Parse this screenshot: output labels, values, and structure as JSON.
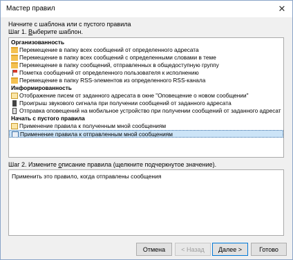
{
  "window": {
    "title": "Мастер правил",
    "close_glyph": "✕"
  },
  "intro": {
    "line1": "Начните с шаблона или с пустого правила",
    "step1_prefix": "Шаг 1. ",
    "step1_acc": "В",
    "step1_suffix": "ыберите шаблон."
  },
  "templates": {
    "groups": [
      {
        "label": "Организованность",
        "items": [
          {
            "icon": "folder-icon",
            "label": "Перемещение в папку всех сообщений от определенного адресата"
          },
          {
            "icon": "folder-icon",
            "label": "Перемещение в папку всех сообщений с определенными словами в теме"
          },
          {
            "icon": "folder-icon",
            "label": "Перемещение в папку сообщений, отправленных в общедоступную группу"
          },
          {
            "icon": "flag-icon",
            "label": "Пометка сообщений от определенного пользователя к исполнению"
          },
          {
            "icon": "folder-icon",
            "label": "Перемещение в папку RSS-элементов из определенного RSS-канала"
          }
        ]
      },
      {
        "label": "Информированность",
        "items": [
          {
            "icon": "envelope-icon",
            "label": "Отображение писем от заданного адресата в окне \"Оповещение о новом сообщении\""
          },
          {
            "icon": "speaker-icon",
            "label": "Проигрыш звукового сигнала при получении сообщений от заданного адресата"
          },
          {
            "icon": "phone-icon",
            "label": "Отправка оповещений на мобильное устройство при получении сообщений от заданного адресат"
          }
        ]
      },
      {
        "label": "Начать с пустого правила",
        "items": [
          {
            "icon": "envelope-icon",
            "label": "Применение правила к полученным мной сообщениям"
          },
          {
            "icon": "send-icon",
            "label": "Применение правила к отправленным мной сообщениям",
            "selected": true
          }
        ]
      }
    ]
  },
  "step2": {
    "prefix": "Шаг 2. Измените ",
    "acc": "о",
    "suffix": "писание правила (щелкните подчеркнутое значение).",
    "description": "Применить это правило, когда отправлены сообщения"
  },
  "buttons": {
    "cancel": "Отмена",
    "back": "< Назад",
    "next": "Далее >",
    "finish": "Готово"
  }
}
